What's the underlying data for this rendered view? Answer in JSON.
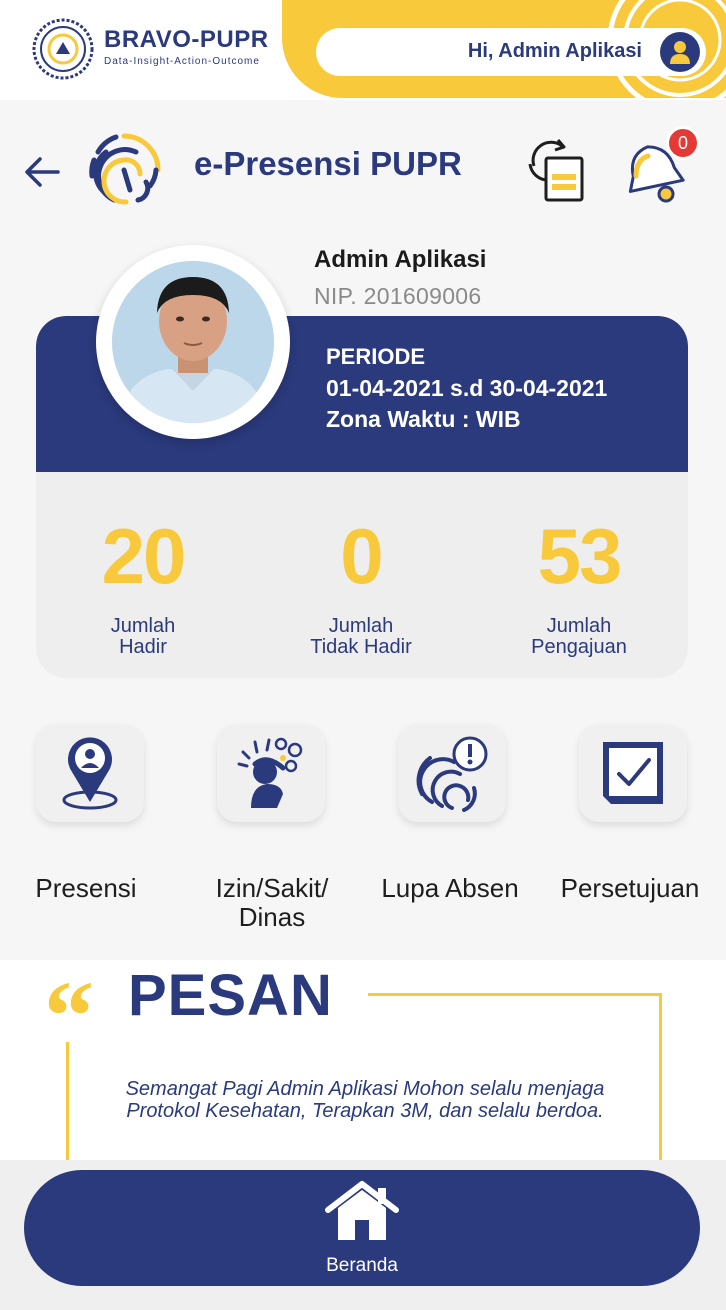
{
  "topbar": {
    "brand_name": "BRAVO-PUPR",
    "brand_tagline": "Data-Insight-Action-Outcome",
    "greeting": "Hi, Admin Aplikasi"
  },
  "header": {
    "title": "e-Presensi PUPR",
    "notification_count": "0"
  },
  "profile": {
    "name": "Admin Aplikasi",
    "nip": "NIP. 201609006"
  },
  "periode": {
    "label": "PERIODE",
    "range": "01-04-2021 s.d 30-04-2021",
    "zona": "Zona Waktu :  WIB"
  },
  "stats": [
    {
      "value": "20",
      "label": "Jumlah\nHadir"
    },
    {
      "value": "0",
      "label": "Jumlah\nTidak Hadir"
    },
    {
      "value": "53",
      "label": "Jumlah\nPengajuan"
    }
  ],
  "menu": [
    {
      "label": "Presensi",
      "icon": "location-pin-person-icon"
    },
    {
      "label": "Izin/Sakit/\nDinas",
      "icon": "sick-person-icon"
    },
    {
      "label": "Lupa Absen",
      "icon": "fingerprint-alert-icon"
    },
    {
      "label": "Persetujuan",
      "icon": "checkbox-approval-icon"
    }
  ],
  "pesan": {
    "title": "PESAN",
    "message": "Semangat Pagi Admin Aplikasi Mohon selalu menjaga Protokol Kesehatan, Terapkan 3M, dan selalu berdoa."
  },
  "bottom_nav": {
    "home_label": "Beranda"
  },
  "colors": {
    "primary": "#2b3a7d",
    "accent": "#f8c93a",
    "badge": "#e53935",
    "background": "#f6f6f6"
  }
}
